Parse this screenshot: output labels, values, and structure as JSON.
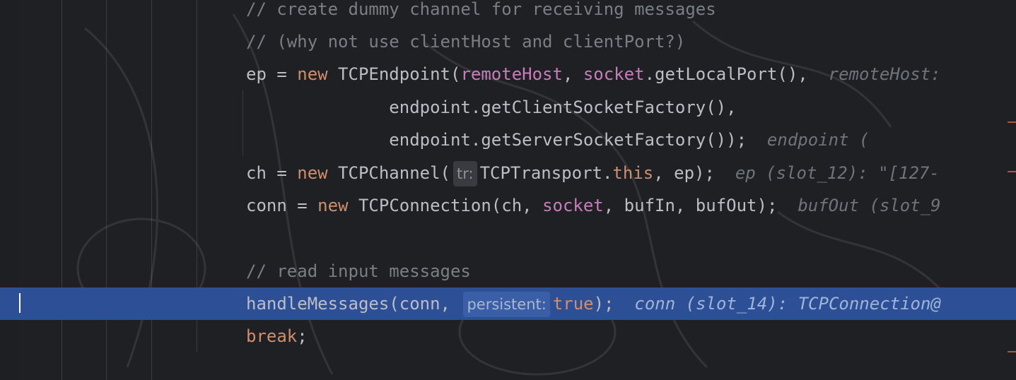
{
  "editor": {
    "lines": [
      {
        "segments": [
          {
            "t": "// create dummy channel for receiving messages",
            "c": "cm"
          }
        ]
      },
      {
        "segments": [
          {
            "t": "// (why not use clientHost and clientPort?)",
            "c": "cm"
          }
        ]
      },
      {
        "segments": [
          {
            "t": "ep = "
          },
          {
            "t": "new",
            "c": "kw"
          },
          {
            "t": " TCPEndpoint("
          },
          {
            "t": "remoteHost",
            "c": "fld"
          },
          {
            "t": ", "
          },
          {
            "t": "socket",
            "c": "fld"
          },
          {
            "t": ".getLocalPort(),  "
          },
          {
            "t": "remoteHost: ",
            "c": "hint"
          }
        ]
      },
      {
        "segments": [
          {
            "t": "              endpoint.getClientSocketFactory(),"
          }
        ]
      },
      {
        "segments": [
          {
            "t": "              endpoint.getServerSocketFactory());  "
          },
          {
            "t": "endpoint (",
            "c": "hint"
          }
        ]
      },
      {
        "segments": [
          {
            "t": "ch = "
          },
          {
            "t": "new",
            "c": "kw"
          },
          {
            "t": " TCPChannel("
          },
          {
            "t": "tr:",
            "c": "inlay"
          },
          {
            "t": "TCPTransport."
          },
          {
            "t": "this",
            "c": "kw"
          },
          {
            "t": ", ep);  "
          },
          {
            "t": "ep (slot_12): \"[127-",
            "c": "hint"
          }
        ]
      },
      {
        "segments": [
          {
            "t": "conn = "
          },
          {
            "t": "new",
            "c": "kw"
          },
          {
            "t": " TCPConnection(ch, "
          },
          {
            "t": "socket",
            "c": "fld"
          },
          {
            "t": ", bufIn, bufOut);  "
          },
          {
            "t": "bufOut (slot_9",
            "c": "hint"
          }
        ]
      },
      {
        "segments": []
      },
      {
        "segments": [
          {
            "t": "// read input messages",
            "c": "cm"
          }
        ]
      },
      {
        "highlight": true,
        "segments": [
          {
            "t": "handleMessages(conn, "
          },
          {
            "t": "persistent:",
            "c": "inlay"
          },
          {
            "t": "true",
            "c": "kw"
          },
          {
            "t": ");  "
          },
          {
            "t": "conn (slot_14): TCPConnection@",
            "c": "hint"
          }
        ]
      },
      {
        "segments": [
          {
            "t": "break",
            "c": "kw"
          },
          {
            "t": ";"
          }
        ]
      }
    ]
  }
}
